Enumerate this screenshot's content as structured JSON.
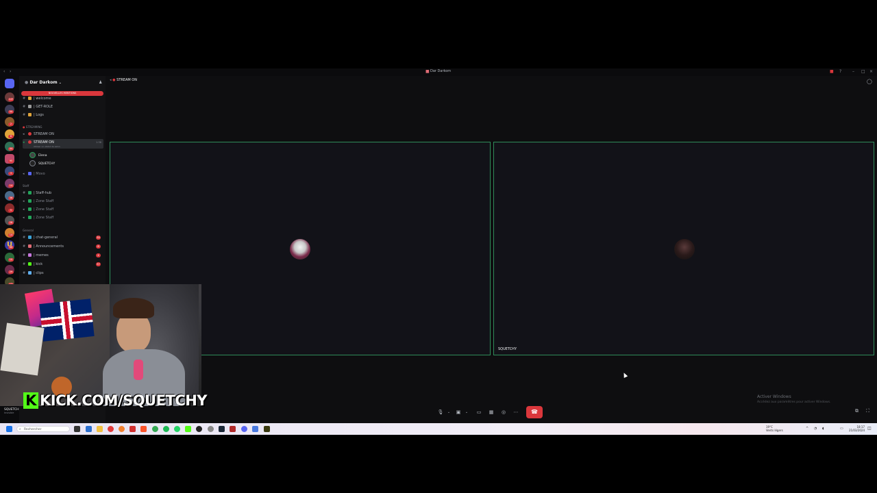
{
  "window": {
    "title": "Dar Darkom"
  },
  "rail": {
    "badges": [
      "147",
      "50",
      "2",
      "6",
      "44",
      "95",
      "3",
      "14",
      "36",
      "5",
      "28",
      "14",
      "66",
      "10",
      "29",
      "17",
      "138"
    ]
  },
  "sidebar": {
    "server_name": "Dar Darkom",
    "mentions_banner": "NOUVELLES MENTIONS",
    "channels_top": [
      {
        "label": "| welcome"
      },
      {
        "label": "| GET-ROLE"
      },
      {
        "label": "| Logs"
      }
    ],
    "category_streaming": "STREAMING",
    "streaming_channels": [
      {
        "label": "STREAM ON"
      },
      {
        "label": "STREAM ON",
        "count": "1:38",
        "subtitle": "Utiliser un statut de salon"
      }
    ],
    "members": [
      {
        "name": "Elena"
      },
      {
        "name": "SQUETCHY"
      }
    ],
    "afk_channel": {
      "label": "| Movo"
    },
    "category_staff": "Staff",
    "staff_channels": [
      {
        "label": "| Staff-hub"
      },
      {
        "label": "| Zone Staff"
      },
      {
        "label": "| Zone Staff"
      },
      {
        "label": "| Zone Staff"
      }
    ],
    "category_general": "General",
    "general_channels": [
      {
        "label": "| chat-general",
        "count": "30"
      },
      {
        "label": "| Announcements",
        "count": "8"
      },
      {
        "label": "| memes",
        "count": "4"
      },
      {
        "label": "| kick",
        "count": "37"
      },
      {
        "label": "| clips"
      }
    ]
  },
  "header": {
    "channel": "STREAM ON"
  },
  "tiles": [
    {
      "name": ""
    },
    {
      "name": "SQUETCHY"
    }
  ],
  "overlay": {
    "kick_text": "KICK.COM/SQUETCHY",
    "kick_letter": "K"
  },
  "user_panel": {
    "name": "SQUETCH",
    "status": "Invisible"
  },
  "watermark": {
    "line1": "Activer Windows",
    "line2": "Accédez aux paramètres pour activer Windows."
  },
  "taskbar": {
    "search_placeholder": "Rechercher",
    "weather_temp": "19°C",
    "weather_desc": "Vents légers",
    "time": "18:17",
    "date": "21/03/2024"
  },
  "colors": {
    "accent_green": "#23a55a",
    "danger_red": "#da373c",
    "kick_green": "#53fc18"
  }
}
